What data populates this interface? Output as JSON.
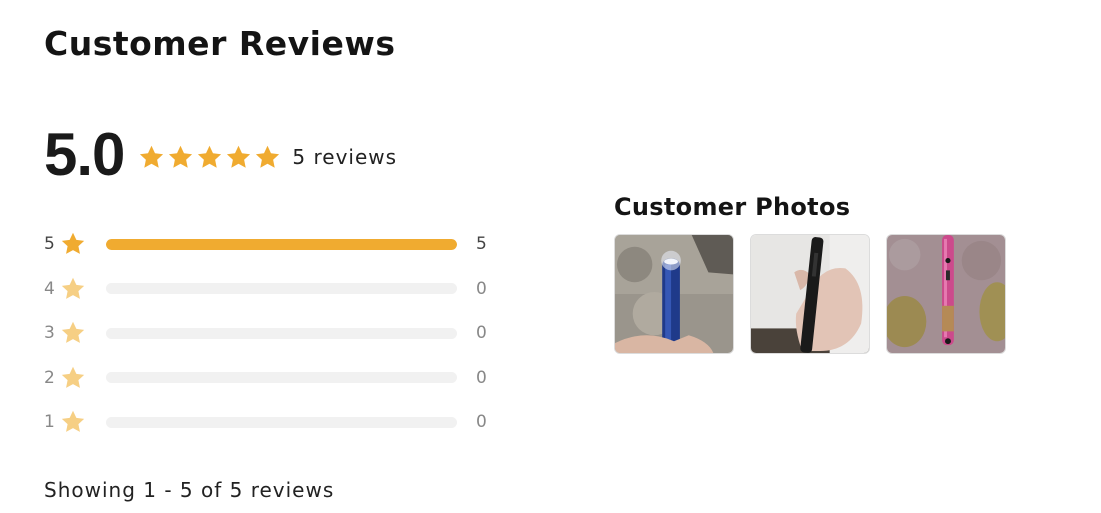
{
  "title": "Customer Reviews",
  "summary": {
    "average": "5.0",
    "rating_stars": 5,
    "review_count_text": "5 reviews"
  },
  "histogram": {
    "rows": [
      {
        "stars": "5",
        "count": "5",
        "fraction": 1.0
      },
      {
        "stars": "4",
        "count": "0",
        "fraction": 0
      },
      {
        "stars": "3",
        "count": "0",
        "fraction": 0
      },
      {
        "stars": "2",
        "count": "0",
        "fraction": 0
      },
      {
        "stars": "1",
        "count": "0",
        "fraction": 0
      }
    ]
  },
  "photos": {
    "title": "Customer Photos",
    "items": [
      {
        "icon": "photo-blue-flashlight"
      },
      {
        "icon": "photo-black-device"
      },
      {
        "icon": "photo-pink-pen"
      }
    ]
  },
  "footer": {
    "showing_text": "Showing 1 - 5 of 5 reviews"
  },
  "colors": {
    "accent": "#f0ab30",
    "star_muted": "#f6cf84",
    "track": "#f1f1f1"
  }
}
